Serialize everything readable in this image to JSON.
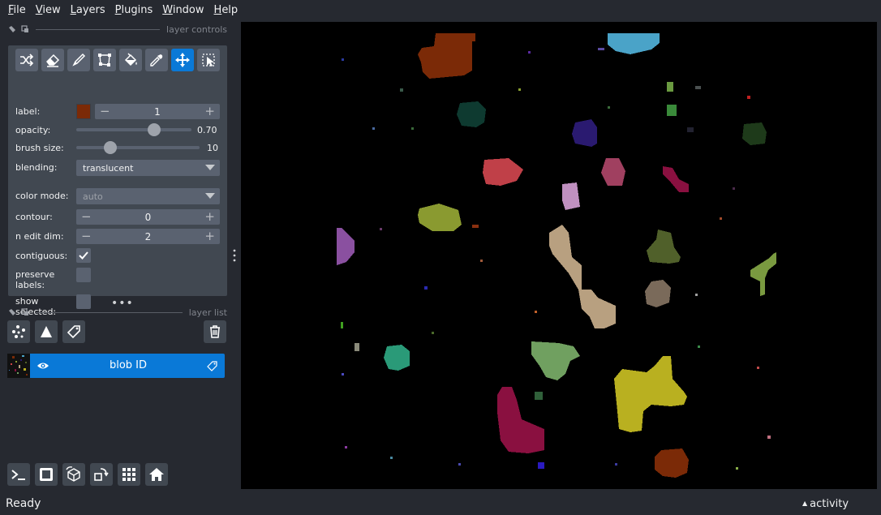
{
  "menubar": {
    "items": [
      {
        "first": "F",
        "rest": "ile"
      },
      {
        "first": "V",
        "rest": "iew"
      },
      {
        "first": "L",
        "rest": "ayers"
      },
      {
        "first": "P",
        "rest": "lugins"
      },
      {
        "first": "W",
        "rest": "indow"
      },
      {
        "first": "H",
        "rest": "elp"
      }
    ]
  },
  "layer_controls": {
    "title": "layer controls",
    "label_label": "label:",
    "label_value": "1",
    "label_color": "#7b2a07",
    "opacity_label": "opacity:",
    "opacity_value": "0.70",
    "opacity_fraction": 0.7,
    "brush_label": "brush size:",
    "brush_value": "10",
    "brush_fraction": 0.25,
    "blending_label": "blending:",
    "blending_value": "translucent",
    "color_mode_label": "color mode:",
    "color_mode_value": "auto",
    "contour_label": "contour:",
    "contour_value": "0",
    "n_edit_dim_label": "n edit dim:",
    "n_edit_dim_value": "2",
    "contiguous_label": "contiguous:",
    "contiguous_checked": true,
    "preserve_labels_label_1": "preserve",
    "preserve_labels_label_2": "labels:",
    "show_selected_label_1": "show",
    "show_selected_label_2": "selected:",
    "tools": [
      "shuffle-icon",
      "eraser-icon",
      "paint-brush-icon",
      "polygon-icon",
      "fill-bucket-icon",
      "color-picker-icon",
      "pan-zoom-icon",
      "transform-icon"
    ],
    "active_tool": "pan-zoom-icon"
  },
  "layer_list": {
    "title": "layer list",
    "layers": [
      {
        "name": "blob ID",
        "visible": true,
        "selected": true
      }
    ]
  },
  "status": {
    "text": "Ready",
    "activity": "activity"
  },
  "colors": {
    "accent": "#0a79d7",
    "panel_bg": "#262930",
    "control_bg": "#414851",
    "canvas_bg": "#000000"
  }
}
